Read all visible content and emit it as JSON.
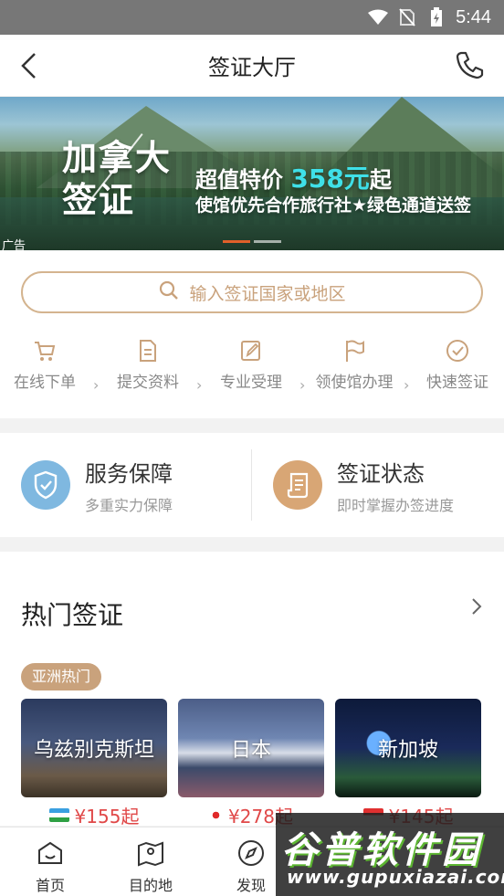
{
  "status_bar": {
    "time": "5:44"
  },
  "header": {
    "title": "签证大厅"
  },
  "banner": {
    "headline_line1": "加拿大",
    "headline_line2": "签证",
    "promo_prefix": "超值特价",
    "promo_price": "358元",
    "promo_suffix": "起",
    "promo_line2": "使馆优先合作旅行社★绿色通道送签",
    "ad_label": "广告",
    "accent_color": "#e0602a"
  },
  "search": {
    "placeholder": "输入签证国家或地区"
  },
  "process_steps": [
    {
      "label": "在线下单",
      "icon": "cart-icon"
    },
    {
      "label": "提交资料",
      "icon": "document-icon"
    },
    {
      "label": "专业受理",
      "icon": "edit-icon"
    },
    {
      "label": "领使馆办理",
      "icon": "flag-icon"
    },
    {
      "label": "快速签证",
      "icon": "check-circle-icon"
    }
  ],
  "services": [
    {
      "title": "服务保障",
      "subtitle": "多重实力保障",
      "icon": "shield-check-icon",
      "color": "#7fb8e0"
    },
    {
      "title": "签证状态",
      "subtitle": "即时掌握办签进度",
      "icon": "receipt-icon",
      "color": "#d8a675"
    }
  ],
  "hot_visa": {
    "title": "热门签证",
    "region_tag": "亚洲热门",
    "items": [
      {
        "name": "乌兹别克斯坦",
        "price": "¥155起"
      },
      {
        "name": "日本",
        "price": "¥278起"
      },
      {
        "name": "新加坡",
        "price": "¥145起"
      }
    ]
  },
  "tabbar": [
    {
      "label": "首页",
      "icon": "home-icon"
    },
    {
      "label": "目的地",
      "icon": "map-icon"
    },
    {
      "label": "发现",
      "icon": "compass-icon"
    }
  ],
  "watermark": {
    "brand": "谷普软件园",
    "url": "www.gupuxiazai.com"
  }
}
